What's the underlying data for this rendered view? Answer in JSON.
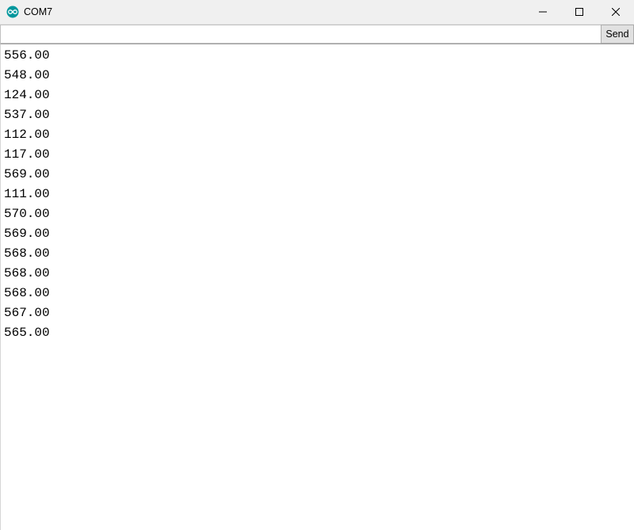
{
  "window": {
    "title": "COM7"
  },
  "input": {
    "value": "",
    "placeholder": ""
  },
  "buttons": {
    "send_label": "Send"
  },
  "serial_output": [
    "556.00",
    "548.00",
    "124.00",
    "537.00",
    "112.00",
    "117.00",
    "569.00",
    "111.00",
    "570.00",
    "569.00",
    "568.00",
    "568.00",
    "568.00",
    "567.00",
    "565.00"
  ]
}
